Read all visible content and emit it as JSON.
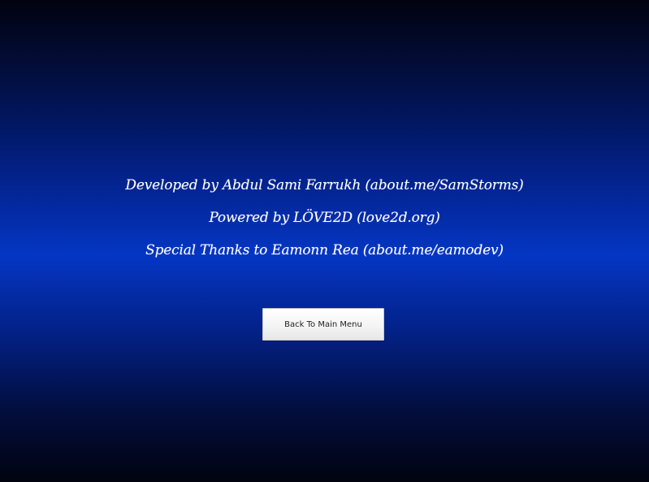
{
  "credits": {
    "lines": [
      "Developed by Abdul Sami Farrukh (about.me/SamStorms)",
      "Powered by LÖVE2D (love2d.org)",
      "Special Thanks to Eamonn Rea (about.me/eamodev)"
    ]
  },
  "back_button": {
    "label": "Back To Main Menu"
  },
  "colors": {
    "background_center": "#0436c4",
    "background_edge": "#01030f",
    "text": "#ffffff",
    "button_bg": "#f3f3f3"
  }
}
